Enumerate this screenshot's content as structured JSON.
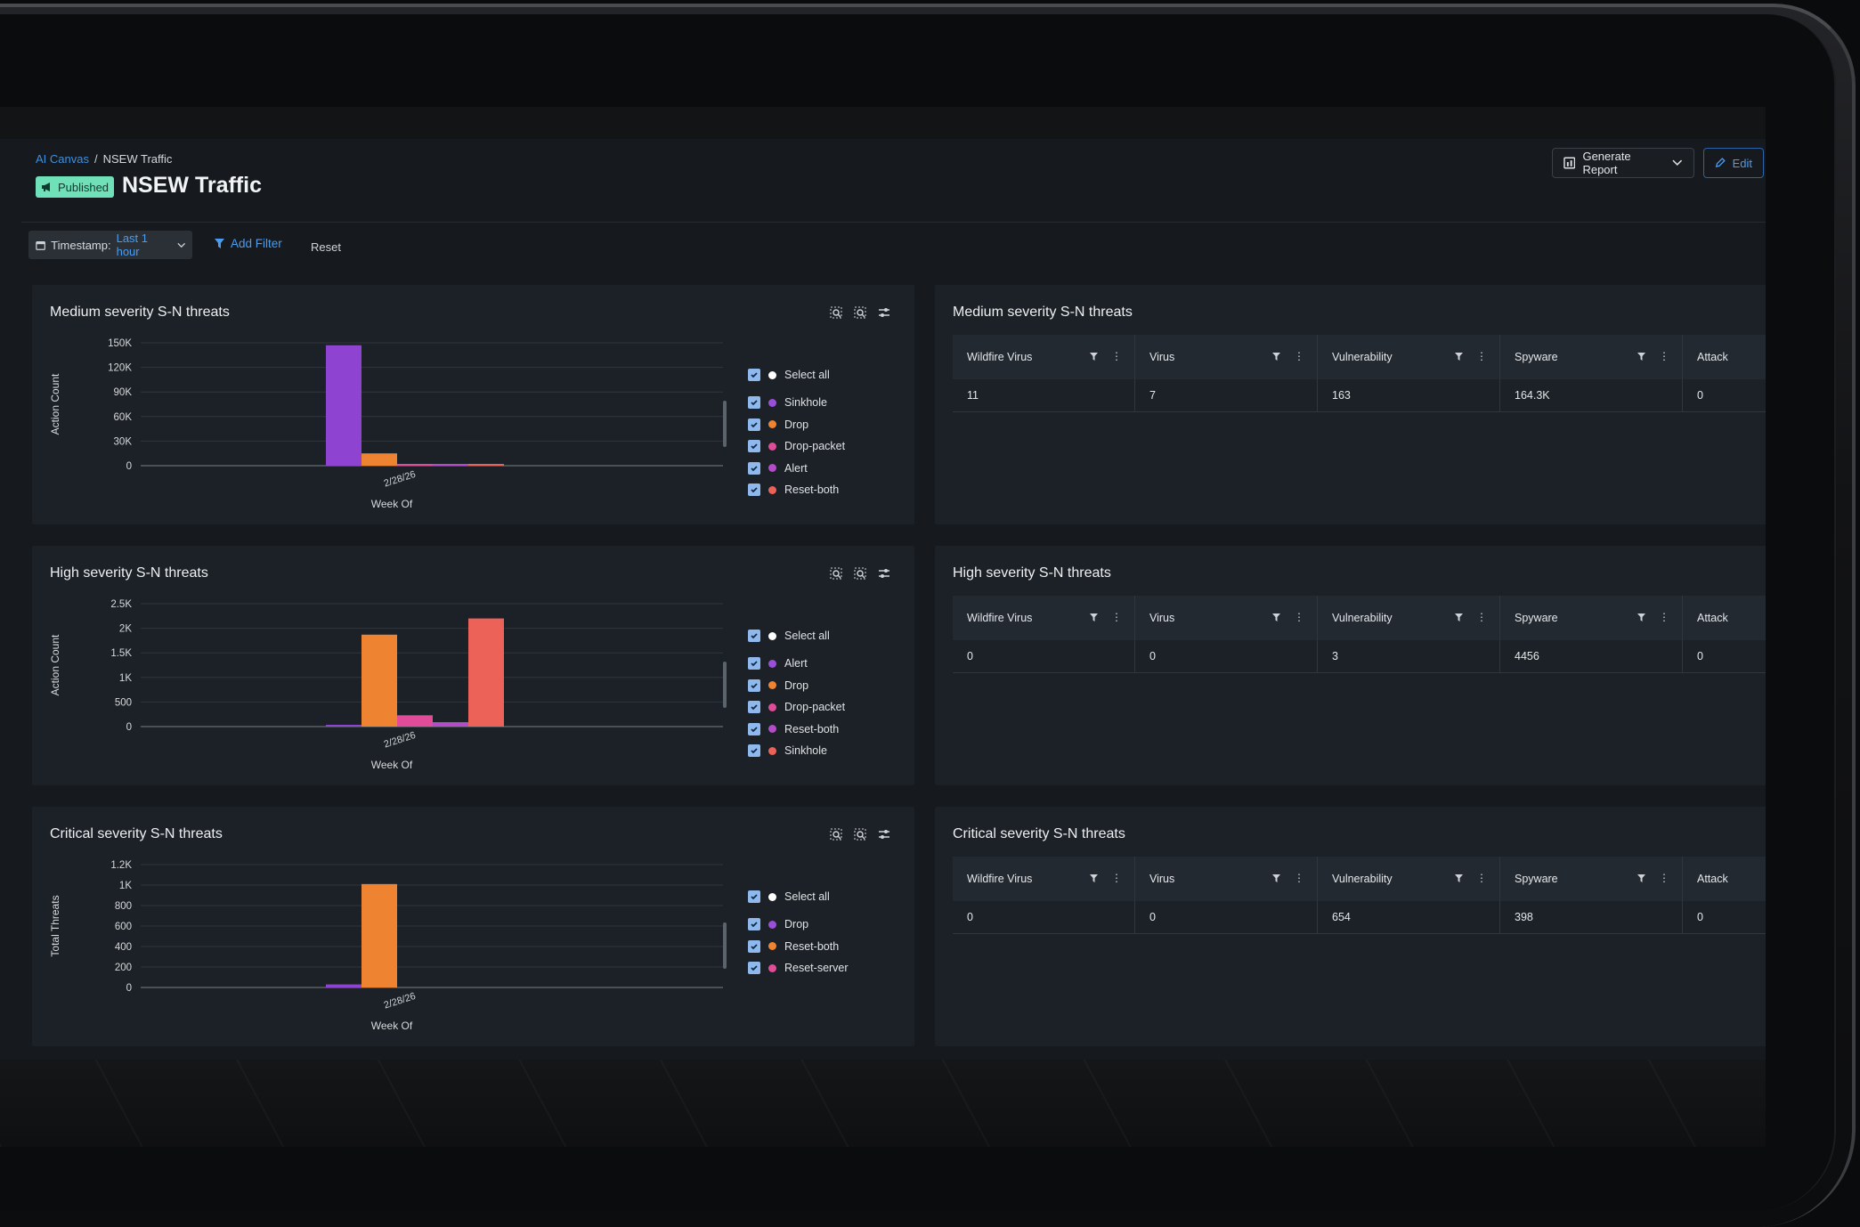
{
  "breadcrumb": {
    "parent": "AI Canvas",
    "separator": "/",
    "current": "NSEW Traffic"
  },
  "header": {
    "status_badge": "Published",
    "title": "NSEW Traffic",
    "generate_report": "Generate Report",
    "edit": "Edit"
  },
  "filters": {
    "timestamp_label": "Timestamp:",
    "timestamp_value": "Last 1 hour",
    "add_filter": "Add Filter",
    "reset": "Reset"
  },
  "colors": {
    "purple": "#8e44d1",
    "orange": "#ee8432",
    "pink": "#e04c98",
    "magenta": "#b44bc9",
    "coral": "#ec6158",
    "badge": "#6fe0b8",
    "accent": "#4b9cf0"
  },
  "charts": [
    {
      "title": "Medium severity S-N threats",
      "legend": [
        {
          "label": "Select all",
          "color": "#ffffff"
        },
        {
          "label": "Sinkhole",
          "color": "#9a4fd8"
        },
        {
          "label": "Drop",
          "color": "#ee8432"
        },
        {
          "label": "Drop-packet",
          "color": "#e04c98"
        },
        {
          "label": "Alert",
          "color": "#b44bc9"
        },
        {
          "label": "Reset-both",
          "color": "#ec6158"
        }
      ]
    },
    {
      "title": "High severity S-N threats",
      "legend": [
        {
          "label": "Select all",
          "color": "#ffffff"
        },
        {
          "label": "Alert",
          "color": "#9a4fd8"
        },
        {
          "label": "Drop",
          "color": "#ee8432"
        },
        {
          "label": "Drop-packet",
          "color": "#e04c98"
        },
        {
          "label": "Reset-both",
          "color": "#b44bc9"
        },
        {
          "label": "Sinkhole",
          "color": "#ec6158"
        }
      ]
    },
    {
      "title": "Critical severity S-N threats",
      "legend": [
        {
          "label": "Select all",
          "color": "#ffffff"
        },
        {
          "label": "Drop",
          "color": "#9a4fd8"
        },
        {
          "label": "Reset-both",
          "color": "#ee8432"
        },
        {
          "label": "Reset-server",
          "color": "#e04c98"
        }
      ]
    }
  ],
  "chart_data": [
    {
      "type": "bar",
      "title": "Medium severity S-N threats",
      "xlabel": "Week Of",
      "ylabel": "Action Count",
      "categories": [
        "2/28/26"
      ],
      "yticks": [
        "150K",
        "120K",
        "90K",
        "60K",
        "30K",
        "0"
      ],
      "ylim": [
        0,
        150000
      ],
      "grid": true,
      "legend_position": "right",
      "series": [
        {
          "name": "Sinkhole",
          "color": "#8e44d1",
          "values": [
            147000
          ]
        },
        {
          "name": "Drop",
          "color": "#ee8432",
          "values": [
            15000
          ]
        },
        {
          "name": "Drop-packet",
          "color": "#e04c98",
          "values": [
            1500
          ]
        },
        {
          "name": "Alert",
          "color": "#b44bc9",
          "values": [
            300
          ]
        },
        {
          "name": "Reset-both",
          "color": "#ec6158",
          "values": [
            100
          ]
        }
      ]
    },
    {
      "type": "bar",
      "title": "High severity S-N threats",
      "xlabel": "Week Of",
      "ylabel": "Action Count",
      "categories": [
        "2/28/26"
      ],
      "yticks": [
        "2.5K",
        "2K",
        "1.5K",
        "1K",
        "500",
        "0"
      ],
      "ylim": [
        0,
        2500
      ],
      "grid": true,
      "legend_position": "right",
      "series": [
        {
          "name": "Alert",
          "color": "#8e44d1",
          "values": [
            30
          ]
        },
        {
          "name": "Drop",
          "color": "#ee8432",
          "values": [
            1870
          ]
        },
        {
          "name": "Drop-packet",
          "color": "#e04c98",
          "values": [
            230
          ]
        },
        {
          "name": "Reset-both",
          "color": "#b44bc9",
          "values": [
            90
          ]
        },
        {
          "name": "Sinkhole",
          "color": "#ec6158",
          "values": [
            2200
          ]
        }
      ]
    },
    {
      "type": "bar",
      "title": "Critical severity S-N threats",
      "xlabel": "Week Of",
      "ylabel": "Total Threats",
      "categories": [
        "2/28/26"
      ],
      "yticks": [
        "1.2K",
        "1K",
        "800",
        "600",
        "400",
        "200",
        "0"
      ],
      "ylim": [
        0,
        1200
      ],
      "grid": true,
      "legend_position": "right",
      "series": [
        {
          "name": "Drop",
          "color": "#8e44d1",
          "values": [
            30
          ]
        },
        {
          "name": "Reset-both",
          "color": "#ee8432",
          "values": [
            1010
          ]
        },
        {
          "name": "Reset-server",
          "color": "#e04c98",
          "values": [
            0
          ]
        }
      ]
    }
  ],
  "tables": [
    {
      "title": "Medium severity S-N threats",
      "columns": [
        "Wildfire Virus",
        "Virus",
        "Vulnerability",
        "Spyware",
        "Attack"
      ],
      "row": [
        "11",
        "7",
        "163",
        "164.3K",
        "0"
      ]
    },
    {
      "title": "High severity S-N threats",
      "columns": [
        "Wildfire Virus",
        "Virus",
        "Vulnerability",
        "Spyware",
        "Attack"
      ],
      "row": [
        "0",
        "0",
        "3",
        "4456",
        "0"
      ]
    },
    {
      "title": "Critical severity S-N threats",
      "columns": [
        "Wildfire Virus",
        "Virus",
        "Vulnerability",
        "Spyware",
        "Attack"
      ],
      "row": [
        "0",
        "0",
        "654",
        "398",
        "0"
      ]
    }
  ]
}
